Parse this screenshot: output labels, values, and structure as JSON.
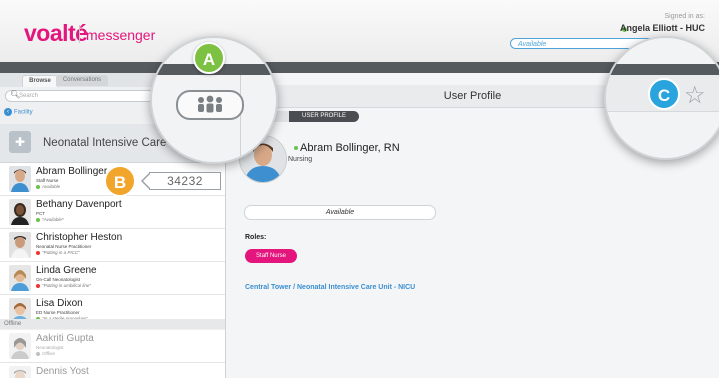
{
  "header": {
    "logo_text": "voalté",
    "logo_sub": "messenger",
    "signed_in_label": "Signed in as:",
    "user_name": "Angela Elliott - HUC",
    "status_value": "Available",
    "brand_color": "#e4157c"
  },
  "sidebar": {
    "tabs": [
      {
        "label": "Browse",
        "active": true
      },
      {
        "label": "Conversations",
        "active": false
      }
    ],
    "search_placeholder": "Search",
    "facility_link": "Facility",
    "unit_name": "Neonatal Intensive Care Unit - NICU",
    "contacts": [
      {
        "name": "Abram Bollinger",
        "role": "Staff Nurse",
        "status": "Available",
        "presence": "green",
        "selected": true
      },
      {
        "name": "Bethany Davenport",
        "role": "PCT",
        "status": "*Available*",
        "presence": "green"
      },
      {
        "name": "Christopher Heston",
        "role": "Neonatal Nurse Practitioner",
        "status": "\"Putting in a PICC\"",
        "presence": "red"
      },
      {
        "name": "Linda Greene",
        "role": "On-Call Neonatologist",
        "status": "\"Putting in umbilical line\"",
        "presence": "red"
      },
      {
        "name": "Lisa Dixon",
        "role": "ED Nurse Practitioner",
        "status": "\"In a sterile procedure\"",
        "presence": "green"
      }
    ],
    "offline_label": "Offline",
    "offline_contacts": [
      {
        "name": "Aakriti Gupta",
        "role": "Neonatologist",
        "status": "Offline"
      },
      {
        "name": "Dennis Yost",
        "role": "",
        "status": ""
      }
    ]
  },
  "profile": {
    "title": "User Profile",
    "subtabs": [
      "CHAT",
      "USER PROFILE"
    ],
    "name": "Abram Bollinger, RN",
    "department": "Nursing",
    "status_bubble": "Available",
    "roles_label": "Roles:",
    "role_badge": "Staff Nurse",
    "unit_link": "Central Tower / Neonatal Intensive Care Unit - NICU"
  },
  "callouts": {
    "a_label": "A",
    "b_label": "B",
    "c_label": "C",
    "pager_number": "34232",
    "a_color": "#7dc142",
    "b_color": "#f2a52b",
    "c_color": "#2aa4dc"
  },
  "icons": [
    "search-icon",
    "back-icon",
    "hospital-unit-icon",
    "group-icon",
    "star-icon",
    "presence-dot-icon"
  ]
}
